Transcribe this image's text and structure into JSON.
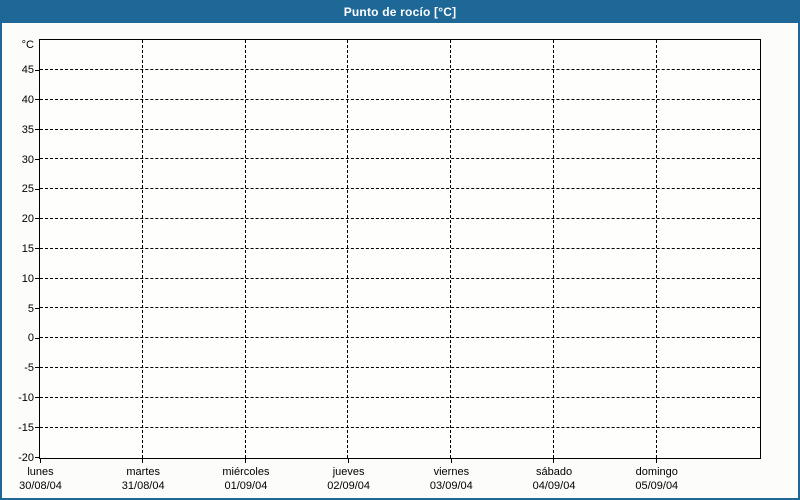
{
  "window": {
    "title": "Punto de rocío [°C]"
  },
  "colors": {
    "titlebar": "#1e6898",
    "window_border": "#1e6898",
    "background": "#fcfdfa",
    "plot_background": "#fefefd",
    "grid": "#000000",
    "title_text": "#ffffff",
    "axis_text": "#000000"
  },
  "chart_data": {
    "type": "line",
    "title": "Punto de rocío [°C]",
    "y_unit_label": "°C",
    "ylim": [
      -20,
      50
    ],
    "ytick_step": 5,
    "ytick_labels": [
      "45",
      "40",
      "35",
      "30",
      "25",
      "20",
      "15",
      "10",
      "5",
      "0",
      "-5",
      "-10",
      "-15",
      "-20"
    ],
    "yticks": [
      45,
      40,
      35,
      30,
      25,
      20,
      15,
      10,
      5,
      0,
      -5,
      -10,
      -15,
      -20
    ],
    "x_categories": [
      {
        "name": "lunes",
        "date": "30/08/04"
      },
      {
        "name": "martes",
        "date": "31/08/04"
      },
      {
        "name": "miércoles",
        "date": "01/09/04"
      },
      {
        "name": "jueves",
        "date": "02/09/04"
      },
      {
        "name": "viernes",
        "date": "03/09/04"
      },
      {
        "name": "sábado",
        "date": "04/09/04"
      },
      {
        "name": "domingo",
        "date": "05/09/04"
      }
    ],
    "series": [],
    "grid": "dashed",
    "legend": "none"
  }
}
